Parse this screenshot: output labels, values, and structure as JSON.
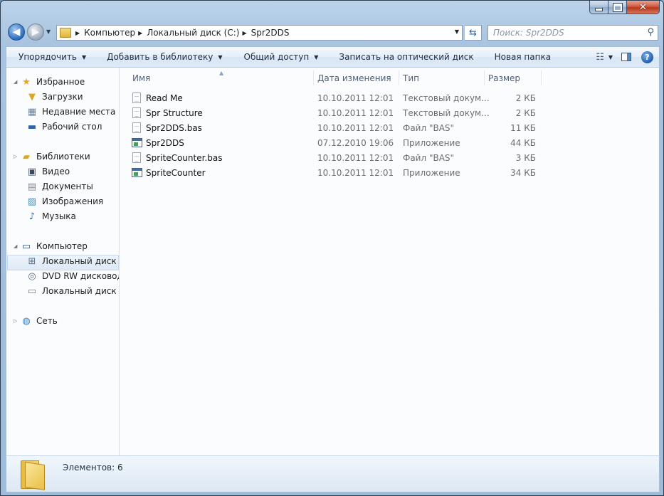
{
  "address": {
    "crumbs": [
      "Компьютер",
      "Локальный диск (C:)",
      "Spr2DDS"
    ]
  },
  "search": {
    "placeholder": "Поиск: Spr2DDS"
  },
  "toolbar": {
    "items": [
      "Упорядочить",
      "Добавить в библиотеку",
      "Общий доступ",
      "Записать на оптический диск",
      "Новая папка"
    ]
  },
  "sidebar": {
    "favorites": {
      "label": "Избранное",
      "items": [
        "Загрузки",
        "Недавние места",
        "Рабочий стол"
      ]
    },
    "libraries": {
      "label": "Библиотеки",
      "items": [
        "Видео",
        "Документы",
        "Изображения",
        "Музыка"
      ]
    },
    "computer": {
      "label": "Компьютер",
      "items": [
        "Локальный диск (C",
        "DVD RW дисковод (",
        "Локальный диск (K"
      ]
    },
    "network": {
      "label": "Сеть"
    }
  },
  "columns": {
    "name": "Имя",
    "date": "Дата изменения",
    "type": "Тип",
    "size": "Размер"
  },
  "files": [
    {
      "name": "Read Me",
      "date": "10.10.2011 12:01",
      "type": "Текстовый докум...",
      "size": "2 КБ",
      "icon": "text-file-icon"
    },
    {
      "name": "Spr Structure",
      "date": "10.10.2011 12:01",
      "type": "Текстовый докум...",
      "size": "2 КБ",
      "icon": "text-file-icon"
    },
    {
      "name": "Spr2DDS.bas",
      "date": "10.10.2011 12:01",
      "type": "Файл \"BAS\"",
      "size": "11 КБ",
      "icon": "text-file-icon"
    },
    {
      "name": "Spr2DDS",
      "date": "07.12.2010 19:06",
      "type": "Приложение",
      "size": "44 КБ",
      "icon": "application-icon"
    },
    {
      "name": "SpriteCounter.bas",
      "date": "10.10.2011 12:01",
      "type": "Файл \"BAS\"",
      "size": "3 КБ",
      "icon": "text-file-icon"
    },
    {
      "name": "SpriteCounter",
      "date": "10.10.2011 12:01",
      "type": "Приложение",
      "size": "34 КБ",
      "icon": "application-icon"
    }
  ],
  "details": {
    "items_count": "Элементов: 6"
  }
}
